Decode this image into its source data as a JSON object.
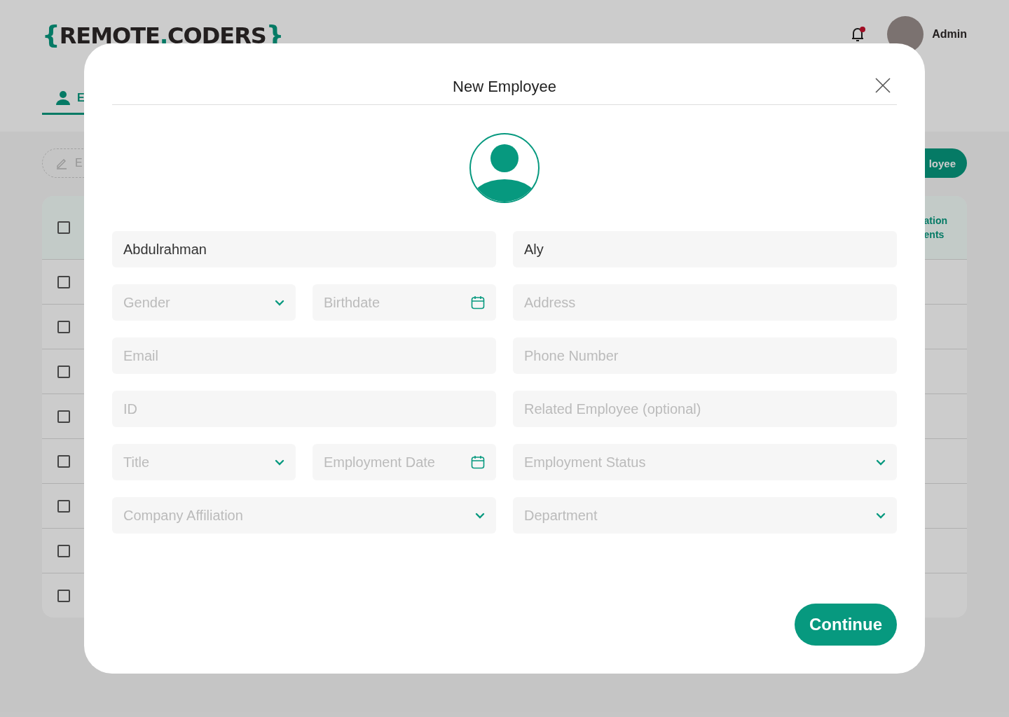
{
  "header": {
    "logo": {
      "open": "{",
      "first": "REMOTE",
      "dot": ".",
      "second": "CODERS",
      "close": "}"
    },
    "user": {
      "name": "Admin",
      "has_notification": true
    }
  },
  "tabs": [
    {
      "label": "E",
      "selected": true
    }
  ],
  "toolbar": {
    "search": {
      "placeholder": "E"
    },
    "add_button": "loyee"
  },
  "table": {
    "header": {
      "checked": false,
      "last_column": [
        "ation",
        "ents"
      ]
    },
    "rows": [
      {
        "checked": false
      },
      {
        "checked": false
      },
      {
        "checked": false
      },
      {
        "checked": false
      },
      {
        "checked": false
      },
      {
        "checked": false
      },
      {
        "checked": false
      },
      {
        "checked": false
      }
    ]
  },
  "modal": {
    "title": "New Employee",
    "rows": [
      [
        {
          "kind": "text",
          "value": "Abdulrahman"
        },
        {
          "kind": "text",
          "value": "Aly"
        }
      ],
      [
        {
          "kind": "select",
          "placeholder": "Gender"
        },
        {
          "kind": "date",
          "placeholder": "Birthdate"
        },
        {
          "kind": "text",
          "placeholder": "Address"
        }
      ],
      [
        {
          "kind": "text",
          "placeholder": "Email"
        },
        {
          "kind": "text",
          "placeholder": "Phone Number"
        }
      ],
      [
        {
          "kind": "text",
          "placeholder": "ID"
        },
        {
          "kind": "text",
          "placeholder": "Related Employee (optional)"
        }
      ],
      [
        {
          "kind": "select",
          "placeholder": "Title"
        },
        {
          "kind": "date",
          "placeholder": "Employment Date"
        },
        {
          "kind": "select",
          "placeholder": "Employment Status"
        }
      ],
      [
        {
          "kind": "select",
          "placeholder": "Company Affiliation"
        },
        {
          "kind": "select",
          "placeholder": "Department"
        }
      ]
    ],
    "continue_button": "Continue"
  }
}
